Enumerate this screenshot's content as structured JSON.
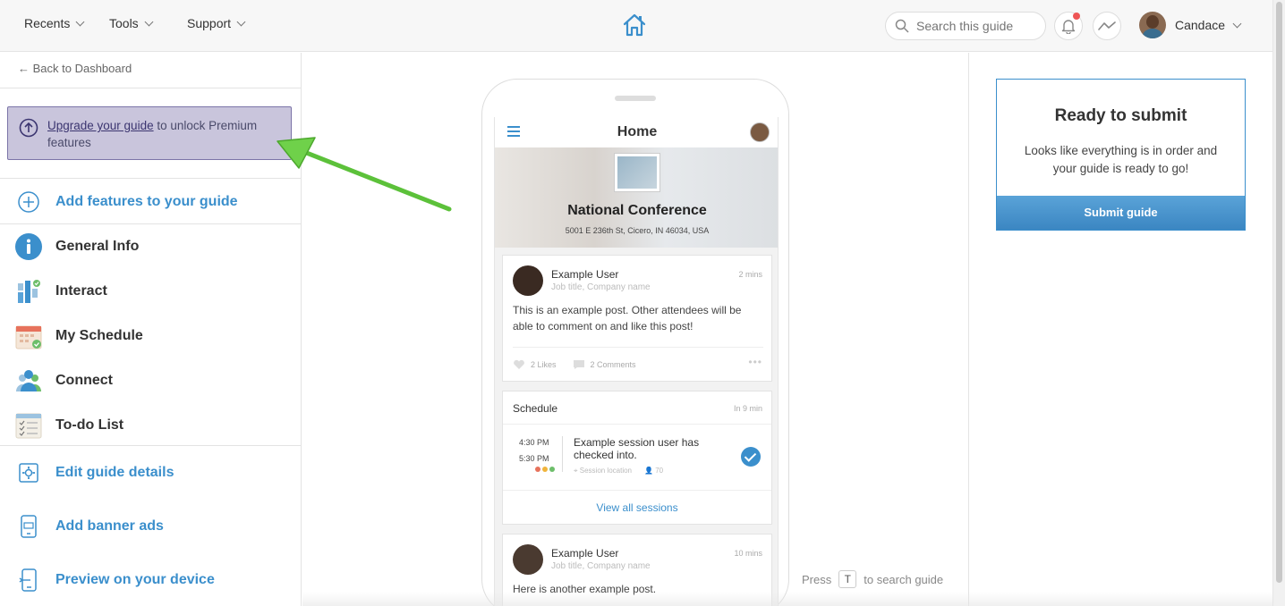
{
  "topbar": {
    "nav": [
      {
        "label": "Recents"
      },
      {
        "label": "Tools"
      },
      {
        "label": "Support"
      }
    ],
    "search_placeholder": "Search this guide",
    "user_name": "Candace"
  },
  "sidebar": {
    "back_label": "← Back to Dashboard",
    "upgrade_link": "Upgrade your guide",
    "upgrade_rest": " to unlock Premium features",
    "items": [
      {
        "label": "Add features to your guide",
        "icon": "plus-circle-icon"
      },
      {
        "label": "General Info",
        "icon": "info-icon"
      },
      {
        "label": "Interact",
        "icon": "interact-icon"
      },
      {
        "label": "My Schedule",
        "icon": "calendar-icon"
      },
      {
        "label": "Connect",
        "icon": "people-icon"
      },
      {
        "label": "To-do List",
        "icon": "checklist-icon"
      },
      {
        "label": "Edit guide details",
        "icon": "settings-icon"
      },
      {
        "label": "Add banner ads",
        "icon": "phone-banner-icon"
      },
      {
        "label": "Preview on your device",
        "icon": "phone-preview-icon"
      }
    ]
  },
  "phone": {
    "title": "Home",
    "event_name": "National Conference",
    "event_address": "5001 E 236th St, Cicero, IN 46034, USA",
    "post1": {
      "name": "Example User",
      "subtitle": "Job title, Company name",
      "time": "2 mins",
      "body": "This is an example post. Other attendees will be able to comment on and like this post!",
      "likes": "2 Likes",
      "comments": "2 Comments"
    },
    "schedule": {
      "heading": "Schedule",
      "in": "In 9 min",
      "start": "4:30 PM",
      "end": "5:30 PM",
      "title": "Example session user has checked into.",
      "location": "Session location",
      "count": "70",
      "view_all": "View all sessions"
    },
    "post2": {
      "name": "Example User",
      "subtitle": "Job title, Company name",
      "time": "10 mins",
      "body": "Here is another example post."
    }
  },
  "hint": {
    "press": "Press",
    "key": "T",
    "rest": "to search guide"
  },
  "submit": {
    "title": "Ready to submit",
    "text": "Looks like everything is in order and your guide is ready to go!",
    "button": "Submit guide"
  },
  "colors": {
    "accent": "#3b8fcc",
    "upgrade_bg": "#c9c5dc",
    "arrow": "#6fd14a"
  }
}
